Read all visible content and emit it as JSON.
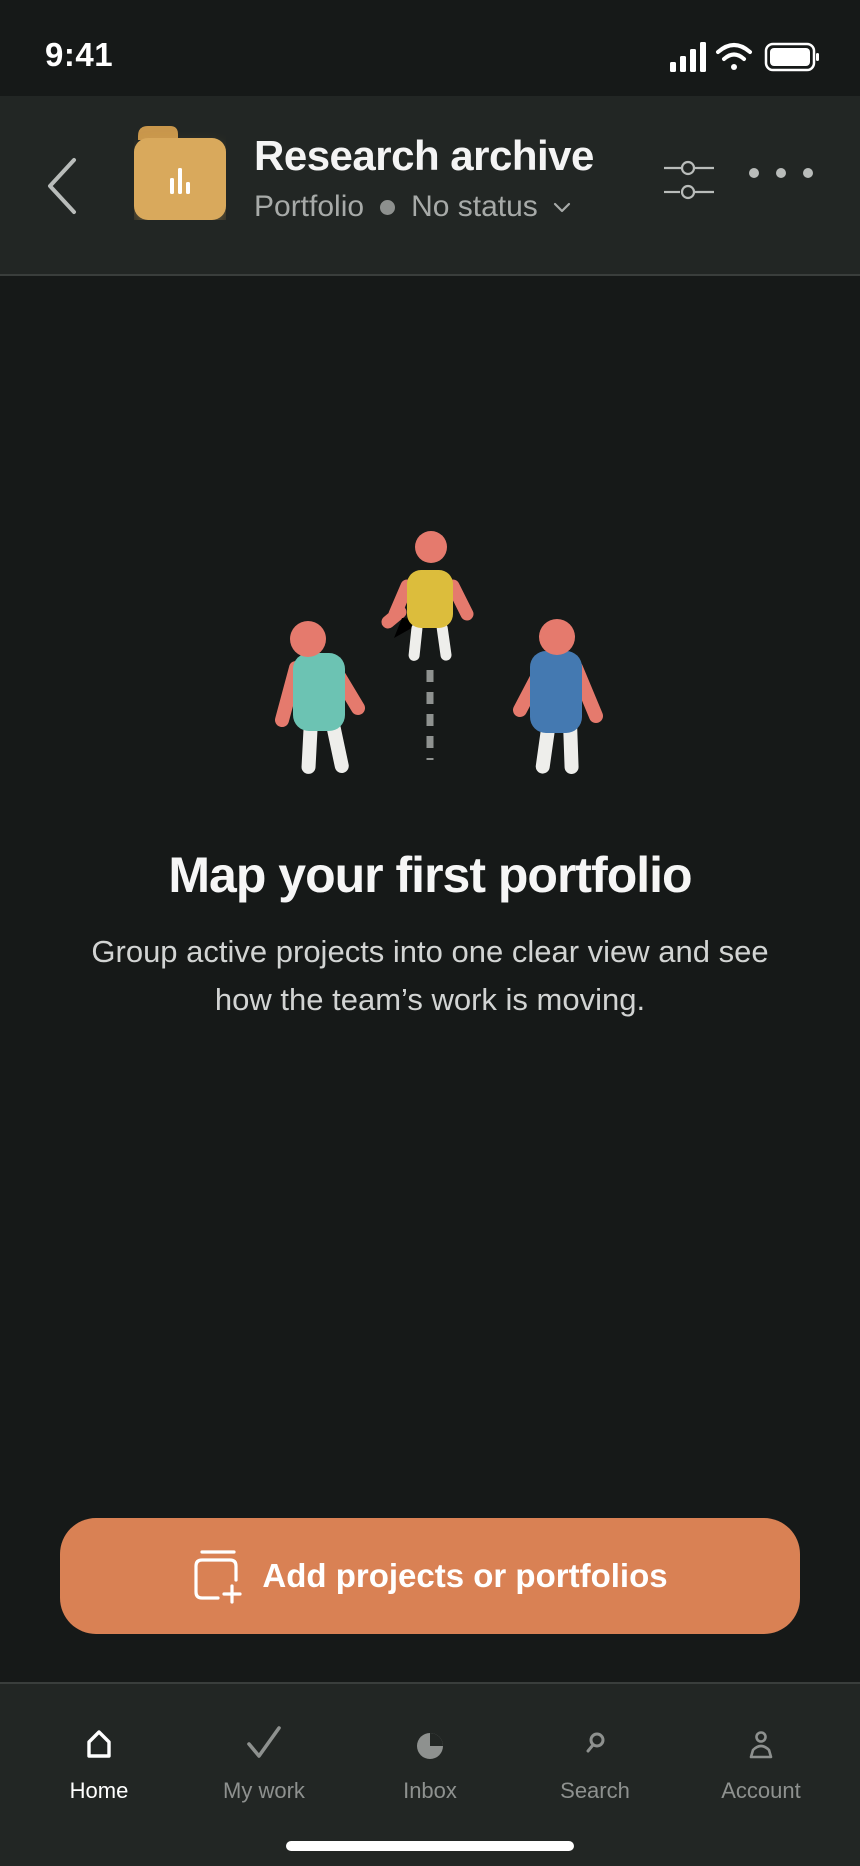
{
  "status_bar": {
    "time": "9:41"
  },
  "header": {
    "title": "Research archive",
    "type_label": "Portfolio",
    "status_label": "No status",
    "folder_color": "#d9a95b"
  },
  "empty_state": {
    "title": "Map your first portfolio",
    "description": "Group active projects into one clear view and see how the team’s work is moving."
  },
  "cta": {
    "label": "Add projects or portfolios",
    "color": "#d98154"
  },
  "tabbar": {
    "tabs": [
      {
        "label": "Home",
        "icon": "home-icon",
        "active": true
      },
      {
        "label": "My work",
        "icon": "check-icon",
        "active": false
      },
      {
        "label": "Inbox",
        "icon": "inbox-icon",
        "active": false
      },
      {
        "label": "Search",
        "icon": "search-icon",
        "active": false
      },
      {
        "label": "Account",
        "icon": "account-icon",
        "active": false
      }
    ]
  }
}
